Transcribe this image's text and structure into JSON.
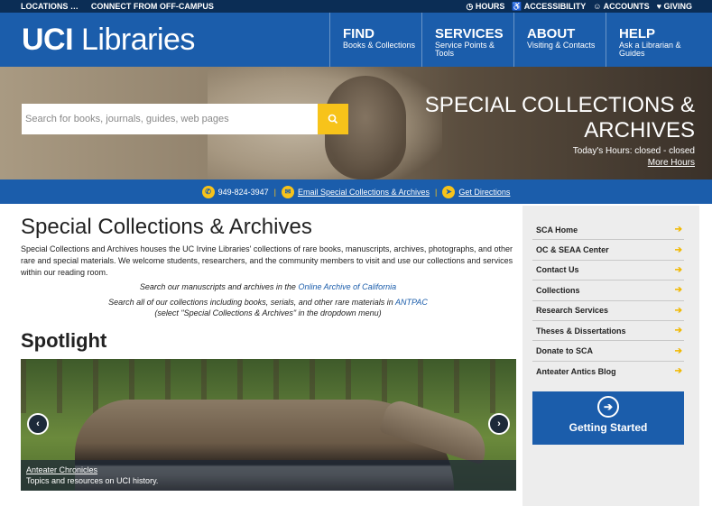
{
  "utility": {
    "locations": "LOCATIONS …",
    "off_campus": "CONNECT FROM OFF-CAMPUS",
    "hours": "◷ HOURS",
    "accessibility": "♿ ACCESSIBILITY",
    "accounts": "☺ ACCOUNTS",
    "giving": "♥ GIVING"
  },
  "header": {
    "logo_uci": "UCI",
    "logo_libraries": "Libraries",
    "nav": [
      {
        "title": "FIND",
        "sub": "Books & Collections"
      },
      {
        "title": "SERVICES",
        "sub": "Service Points & Tools"
      },
      {
        "title": "ABOUT",
        "sub": "Visiting & Contacts"
      },
      {
        "title": "HELP",
        "sub": "Ask a Librarian & Guides"
      }
    ]
  },
  "hero": {
    "search_placeholder": "Search for books, journals, guides, web pages",
    "title": "SPECIAL COLLECTIONS & ARCHIVES",
    "hours_text": "Today's Hours:  closed - closed",
    "more_hours": "More Hours"
  },
  "contact": {
    "phone": "949-824-3947",
    "email": "Email Special Collections & Archives",
    "directions": "Get Directions",
    "separator": "|"
  },
  "main": {
    "title": "Special Collections & Archives",
    "intro": "Special Collections and Archives houses the UC Irvine Libraries' collections of rare books, manuscripts, archives, photographs, and other rare and special materials.  We welcome students, researchers, and the community members to visit and use our collections and services within our reading room.",
    "search_line_prefix": "Search our manuscripts and archives in the ",
    "search_line_link": "Online Archive of California",
    "all_line_prefix": "Search all of our collections including books, serials, and other rare materials in ",
    "all_line_link": "ANTPAC",
    "all_line_note": "(select \"Special Collections & Archives\" in the dropdown menu)",
    "spotlight_title": "Spotlight",
    "spotlight_link": "Anteater Chronicles",
    "spotlight_desc": "Topics and resources on UCI history.",
    "prev_label": "‹",
    "next_label": "›"
  },
  "sidebar": {
    "items": [
      {
        "label": "SCA Home"
      },
      {
        "label": "OC & SEAA Center"
      },
      {
        "label": "Contact Us"
      },
      {
        "label": "Collections"
      },
      {
        "label": "Research Services"
      },
      {
        "label": "Theses & Dissertations"
      },
      {
        "label": "Donate to SCA"
      },
      {
        "label": "Anteater Antics Blog"
      }
    ],
    "arrow": "➔",
    "getting_started": "Getting Started",
    "getting_icon": "➔"
  },
  "colors": {
    "navy": "#0b2d55",
    "blue": "#1b5dab",
    "gold": "#f7c31a"
  }
}
